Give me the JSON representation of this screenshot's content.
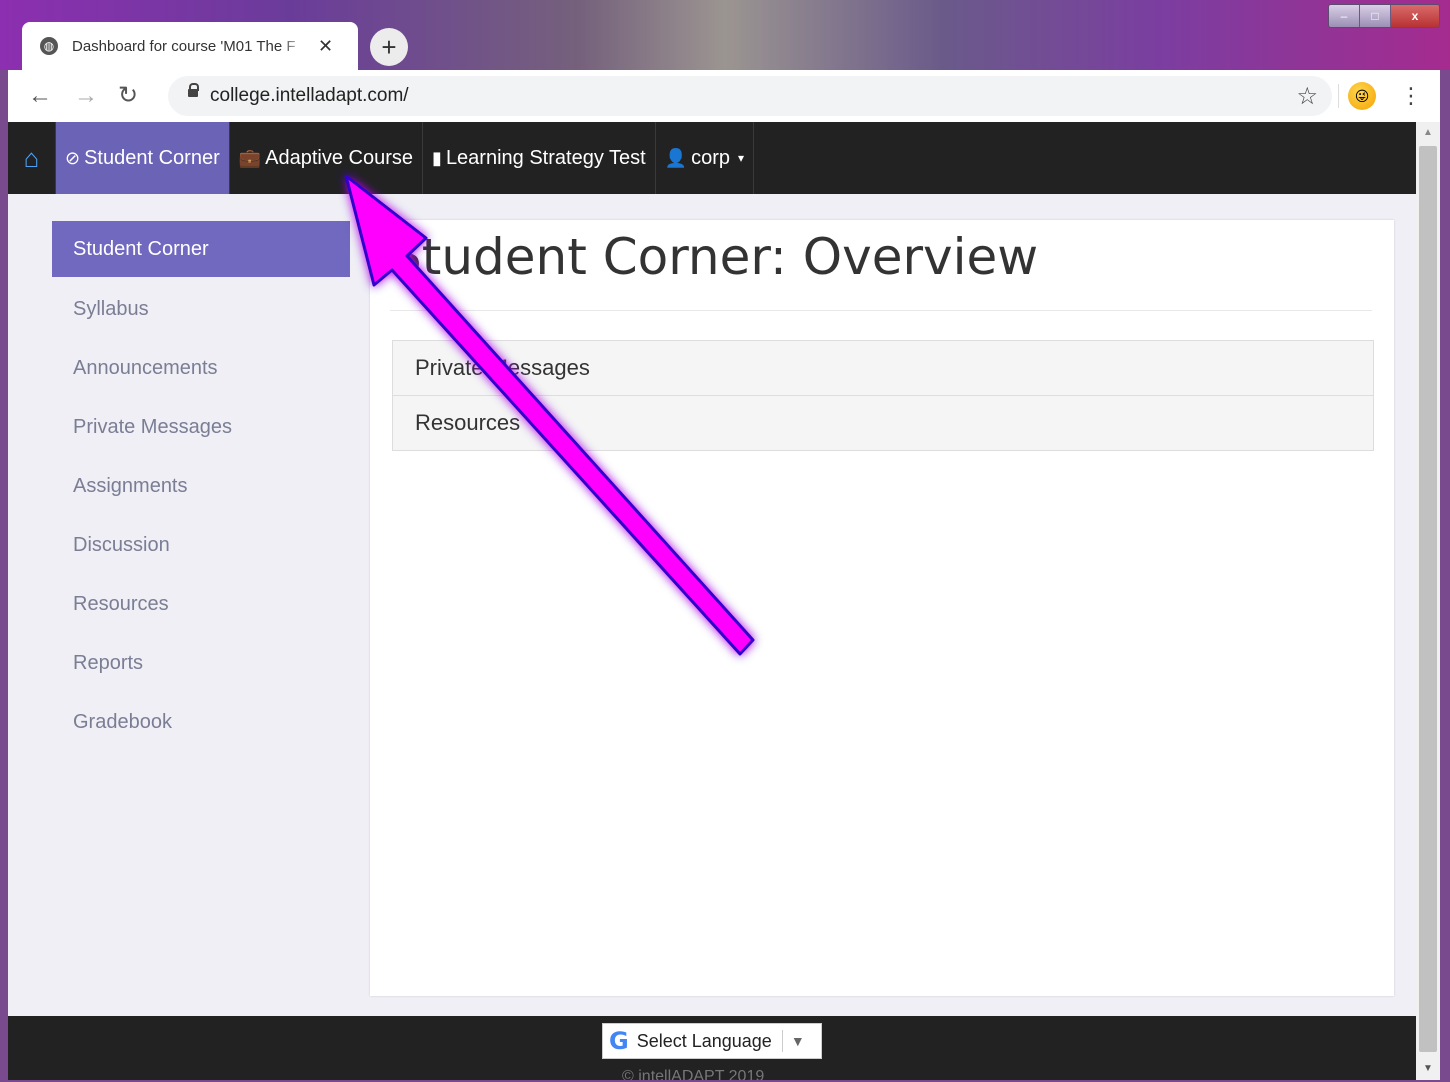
{
  "browser": {
    "tab_title": "Dashboard for course 'M01 The F",
    "tab_close": "✕",
    "new_tab": "+",
    "url": "college.intelladapt.com/",
    "window_controls": {
      "minimize": "–",
      "maximize": "□",
      "close": "x"
    }
  },
  "topnav": {
    "items": [
      {
        "label": "Student Corner",
        "icon": "clock-icon",
        "glyph": "⊘"
      },
      {
        "label": "Adaptive Course",
        "icon": "briefcase-icon",
        "glyph": "💼"
      },
      {
        "label": "Learning Strategy Test",
        "icon": "book-icon",
        "glyph": "▮"
      },
      {
        "label": "corp",
        "icon": "user-icon",
        "glyph": "👤",
        "caret": "▾"
      }
    ]
  },
  "sidebar": {
    "items": [
      {
        "label": "Student Corner",
        "active": true
      },
      {
        "label": "Syllabus"
      },
      {
        "label": "Announcements"
      },
      {
        "label": "Private Messages"
      },
      {
        "label": "Assignments"
      },
      {
        "label": "Discussion"
      },
      {
        "label": "Resources"
      },
      {
        "label": "Reports"
      },
      {
        "label": "Gradebook"
      }
    ]
  },
  "main": {
    "title": "Student Corner: Overview",
    "panels": [
      "Private Messages",
      "Resources"
    ]
  },
  "footer": {
    "language_label": "Select Language",
    "language_arrow": "▼",
    "copyright": "© intellADAPT 2019"
  },
  "colors": {
    "nav_active": "#6b63b5",
    "sidebar_active": "#7168bf",
    "arrow_fill": "#ff00ff",
    "arrow_outline": "#3300cc"
  }
}
